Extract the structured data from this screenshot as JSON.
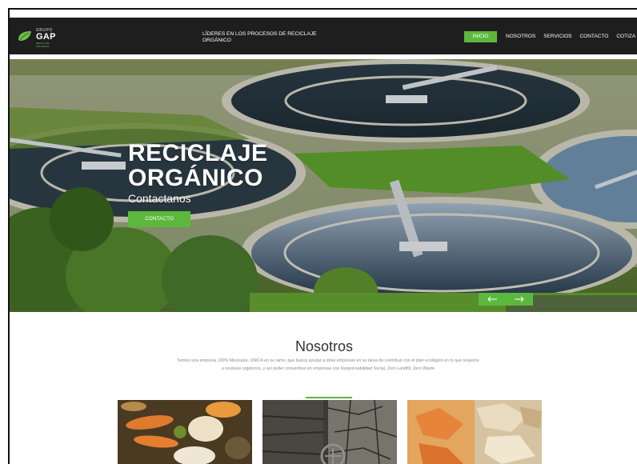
{
  "brand": {
    "small": "GRUPO",
    "big": "GAP",
    "tiny": "RECICLAJE ORGANICO"
  },
  "header": {
    "tagline": "LÍDERES EN LOS PROCESOS DE RECICLAJE ORGÁNICO"
  },
  "nav": {
    "items": [
      "INICIO",
      "NOSOTROS",
      "SERVICIOS",
      "CONTACTO",
      "COTIZA"
    ],
    "active": "INICIO"
  },
  "hero": {
    "title_line1": "RECICLAJE",
    "title_line2": "ORGÁNICO",
    "subtitle": "Contactanos",
    "button": "CONTACTO",
    "prev_icon": "arrow-left-icon",
    "next_icon": "arrow-right-icon"
  },
  "nosotros": {
    "title": "Nosotros",
    "text": "Somos una empresa 100% Mexicana, UNICA en su ramo, que busca ayudar a otras empresas en su tarea de contribuir con el plan ecológico en lo que respecta a residuos orgánicos, y así poder convertirse en empresas con Responsabilidad Social, Zero Landfill, Zero Waste"
  },
  "colors": {
    "accent": "#5cb83c",
    "header_bg": "#1e1e1e",
    "title_text": "#333333",
    "body_text": "#8a8a8a"
  }
}
